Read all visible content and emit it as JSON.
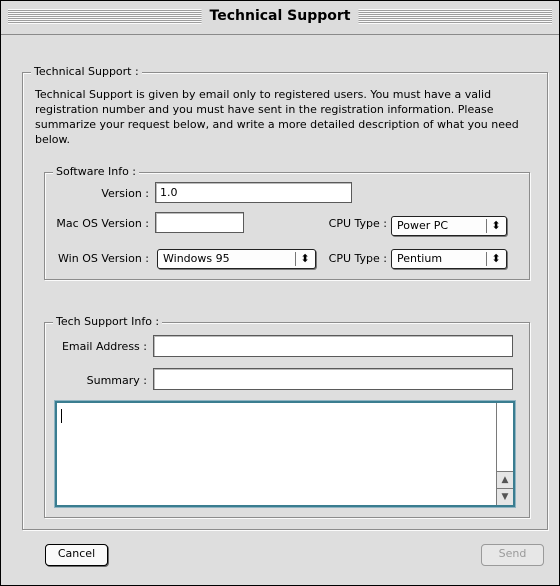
{
  "window": {
    "title": "Technical Support"
  },
  "technical_support": {
    "legend": "Technical Support :",
    "description": "Technical Support is given by email only to registered users. You must have a valid registration number and you must have sent in the registration information.  Please summarize your request below, and write a more detailed description of what you need below."
  },
  "software_info": {
    "legend": "Software Info :",
    "version_label": "Version :",
    "version_value": "1.0",
    "mac_os_label": "Mac OS Version :",
    "mac_os_value": "",
    "cpu_type_mac_label": "CPU Type :",
    "cpu_type_mac_value": "Power PC",
    "win_os_label": "Win OS Version :",
    "win_os_value": "Windows 95",
    "cpu_type_win_label": "CPU Type :",
    "cpu_type_win_value": "Pentium"
  },
  "tech_support_info": {
    "legend": "Tech Support Info :",
    "email_label": "Email Address :",
    "email_value": "",
    "summary_label": "Summary :",
    "summary_value": "",
    "details_value": ""
  },
  "buttons": {
    "cancel": "Cancel",
    "send": "Send"
  },
  "icons": {
    "popup_arrows": "up-down-arrows-icon",
    "scroll_up": "scroll-up-arrow-icon",
    "scroll_down": "scroll-down-arrow-icon"
  }
}
